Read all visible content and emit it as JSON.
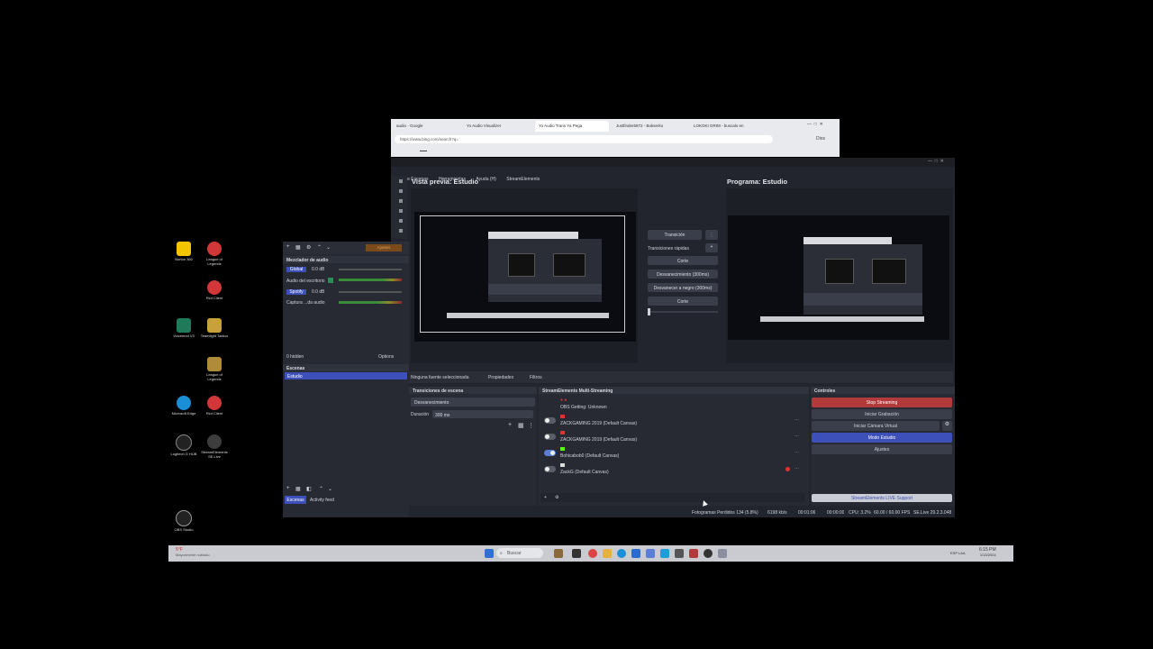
{
  "desktop": {
    "icons": [
      {
        "label": "Norton 360"
      },
      {
        "label": "League of Legends"
      },
      {
        "label": "Riot Client"
      },
      {
        "label": "Voicemod V3"
      },
      {
        "label": "Teamfight Tactics"
      },
      {
        "label": "League of Legends"
      },
      {
        "label": "Microsoft Edge"
      },
      {
        "label": "Riot Client"
      },
      {
        "label": "Logitech G HUB"
      },
      {
        "label": "StreamElements SE.Live"
      },
      {
        "label": "OBS Studio"
      }
    ]
  },
  "browser": {
    "tabs": [
      {
        "label": "audio - Google"
      },
      {
        "label": "Yo Audio Visualizer"
      },
      {
        "label": "Yo Audio Trans Ya Pega"
      },
      {
        "label": "Justfinder6872 - Bokserko"
      },
      {
        "label": "LOKOKI GRIM - buscalo en"
      }
    ],
    "url": "https://www.bing.com/search?q=",
    "profile": "Dios"
  },
  "obs": {
    "menu": [
      "ación de Escenas",
      "Herramientas",
      "Ayuda (H)",
      "StreamElements"
    ],
    "preview_title": "Vista previa: Estudio",
    "program_title": "Programa: Estudio",
    "transition": {
      "button": "Transición",
      "quick_label": "Transiciones rápidas",
      "items": [
        "Corte",
        "Desvanecimiento (300ms)",
        "Desvanecer a negro (300ms)",
        "Corte"
      ]
    },
    "source_bar": {
      "none_selected": "Ninguna fuente seleccionada",
      "properties": "Propiedades",
      "filters": "Filtros"
    },
    "scene_transitions": {
      "title": "Transiciones de escena",
      "type": "Desvanecimiento",
      "duration_label": "Duración",
      "duration_value": "300 ms"
    },
    "multistream": {
      "title": "StreamElements Multi-Streaming",
      "rows": [
        {
          "name": "OBS Getting: Unknown",
          "on": false
        },
        {
          "name": "ZACKGAMING 2019 (Default Canvas)",
          "on": false
        },
        {
          "name": "ZACKGAMING 2019 (Default Canvas)",
          "on": false
        },
        {
          "name": "Bohicabob0 (Default Canvas)",
          "on": true
        },
        {
          "name": "ZackG (Default Canvas)",
          "on": false
        }
      ]
    },
    "controls": {
      "title": "Controles",
      "stop_streaming": "Stop Streaming",
      "start_recording": "Iniciar Grabación",
      "virtual_cam": "Iniciar Cámara Virtual",
      "studio_mode": "Modo Estudio",
      "settings": "Ajustes",
      "footer": "StreamElements LIVE Support"
    },
    "status": {
      "dropped": "Fotogramas Perdidos 134 (5.8%)",
      "kbps": "6198 kb/s",
      "live": "00:01:06",
      "rec": "00:00:00",
      "cpu": "CPU: 3.2%",
      "fps": "60.00 / 60.00 FPS",
      "version": "SE.Live 29.2.3.048"
    },
    "accent_red": "#b23a3a",
    "accent_blue": "#3d4fb8"
  },
  "leftpanel": {
    "top_button": "Ajustes",
    "mixer_title": "Mezclador de audio",
    "channels": [
      {
        "name": "Global",
        "db": "0.0 dB"
      },
      {
        "name": "Audio del escritorio",
        "db": "0.0 dB"
      },
      {
        "name": "Spotify",
        "db": "0.0 dB"
      },
      {
        "name": "Captura ...da audio",
        "db": "0.0 dB"
      }
    ],
    "hidden": "0 hidden",
    "options": "Options",
    "scenes_title": "Escenas",
    "scene_selected": "Estudio",
    "tab_scenes": "Escenas",
    "tab_activity": "Activity feed"
  },
  "taskbar": {
    "notification": "5°F",
    "notification_sub": "Mayormente nublado",
    "search": "Buscar",
    "time": "6:15 PM",
    "date": "1/13/2024",
    "lang": "ESP LAA"
  }
}
